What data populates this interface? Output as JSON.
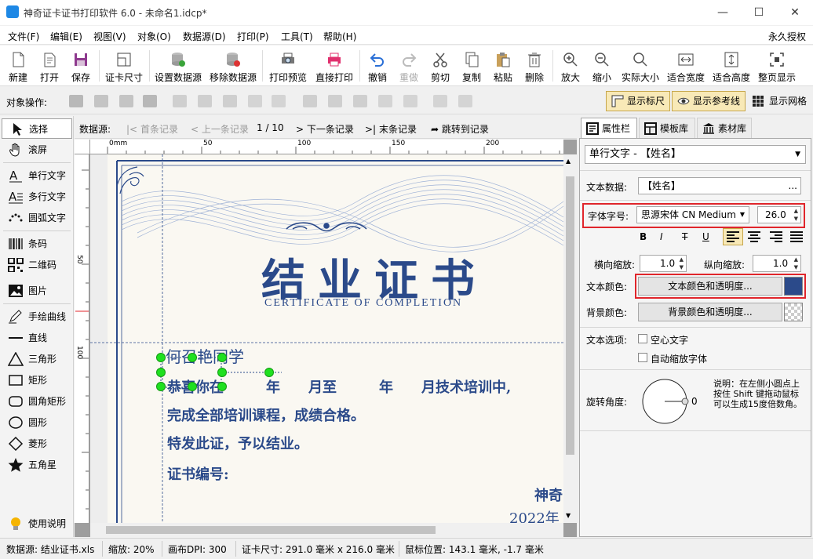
{
  "window": {
    "title": "神奇证卡证书打印软件 6.0 - 未命名1.idcp*",
    "minimize_glyph": "—",
    "maximize_glyph": "☐",
    "close_glyph": "✕"
  },
  "menu": {
    "items": [
      "文件(F)",
      "编辑(E)",
      "视图(V)",
      "对象(O)",
      "数据源(D)",
      "打印(P)",
      "工具(T)",
      "帮助(H)"
    ],
    "license": "永久授权"
  },
  "toolbar": {
    "items": [
      "新建",
      "打开",
      "保存",
      "证卡尺寸",
      "设置数据源",
      "移除数据源",
      "打印预览",
      "直接打印",
      "撤销",
      "重做",
      "剪切",
      "复制",
      "粘贴",
      "删除",
      "放大",
      "缩小",
      "实际大小",
      "适合宽度",
      "适合高度",
      "整页显示"
    ]
  },
  "objbar": {
    "label": "对象操作:",
    "show_ruler": "显示标尺",
    "show_guides": "显示参考线",
    "show_grid": "显示网格"
  },
  "tools": {
    "items": [
      "选择",
      "滚屏",
      "单行文字",
      "多行文字",
      "圆弧文字",
      "条码",
      "二维码",
      "图片",
      "手绘曲线",
      "直线",
      "三角形",
      "矩形",
      "圆角矩形",
      "圆形",
      "菱形",
      "五角星"
    ],
    "help": "使用说明"
  },
  "nav": {
    "datasource_label": "数据源:",
    "first": "首条记录",
    "prev": "上一条记录",
    "counter": "1 / 10",
    "next": "下一条记录",
    "last": "末条记录",
    "jump": "跳转到记录"
  },
  "ruler": {
    "h_labels": [
      "0mm",
      "50",
      "100",
      "150",
      "200"
    ],
    "v_labels": [
      "50",
      "100"
    ]
  },
  "certificate": {
    "title": "结业证书",
    "subtitle": "CERTIFICATE OF COMPLETION",
    "name": "何召艳同学",
    "line1": "恭喜你在　　　年　　月至　　　年　　月技术培训中,",
    "line2": "完成全部培训课程，成绩合格。",
    "line3": "特发此证，予以结业。",
    "line4": "证书编号:",
    "issuer": "神奇",
    "year": "2022年"
  },
  "panel": {
    "tabs": [
      "属性栏",
      "模板库",
      "素材库"
    ],
    "object_select": "单行文字 - 【姓名】",
    "text_data_label": "文本数据:",
    "text_data_value": "【姓名】",
    "ellipsis": "...",
    "font_label": "字体字号:",
    "font_name": "思源宋体 CN Medium",
    "font_size": "26.0",
    "format_buttons": [
      "B",
      "I",
      "T",
      "U"
    ],
    "hscale_label": "横向缩放:",
    "hscale_value": "1.0",
    "vscale_label": "纵向缩放:",
    "vscale_value": "1.0",
    "text_color_label": "文本颜色:",
    "text_color_btn": "文本颜色和透明度...",
    "text_color": "#2b4a8a",
    "bg_color_label": "背景颜色:",
    "bg_color_btn": "背景颜色和透明度...",
    "options_label": "文本选项:",
    "option_hollow": "空心文字",
    "option_autoscale": "自动缩放字体",
    "rotate_label": "旋转角度:",
    "rotate_value": "0",
    "rotate_hint": "说明：在左侧小圆点上按住 Shift 键拖动鼠标可以生成15度倍数角。"
  },
  "status": {
    "datasource": "数据源: 结业证书.xls",
    "zoom": "缩放: 20%",
    "dpi": "画布DPI: 300",
    "size": "证卡尺寸: 291.0 毫米 x 216.0 毫米",
    "mouse": "鼠标位置: 143.1 毫米, -1.7 毫米"
  },
  "colors": {
    "accent": "#1e88e5",
    "cert_blue": "#2b4a8a",
    "highlight_red": "#e0252b",
    "handle_green": "#1fe01f"
  }
}
